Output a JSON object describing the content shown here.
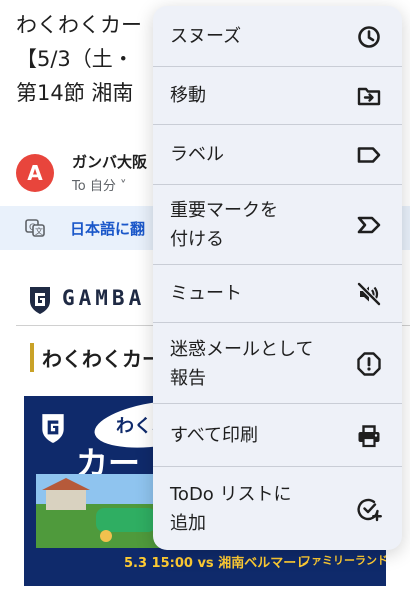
{
  "email": {
    "subject_lines": [
      "わくわくカー",
      "【5/3（土・",
      "第14節 湘南"
    ],
    "sender_name": "ガンバ大阪",
    "recipient": "To 自分 ˅",
    "avatar_letter": "A",
    "translate_text": "日本語に翻",
    "logo_text": "GAMBA",
    "section_heading": "わくわくカー",
    "banner": {
      "bubble_text": "わくわく",
      "title": "カー",
      "date_text": "5.3 15:00 vs 湘南ベルマーレ",
      "family_text": "ファミリーランド"
    }
  },
  "menu": {
    "items": [
      {
        "label": "スヌーズ",
        "icon": "clock-icon"
      },
      {
        "label": "移動",
        "icon": "move-to-folder-icon"
      },
      {
        "label": "ラベル",
        "icon": "label-icon"
      },
      {
        "label": "重要マークを\n付ける",
        "icon": "important-marker-icon"
      },
      {
        "label": "ミュート",
        "icon": "mute-icon"
      },
      {
        "label": "迷惑メールとして\n報告",
        "icon": "report-spam-icon"
      },
      {
        "label": "すべて印刷",
        "icon": "print-icon"
      },
      {
        "label": "ToDo リストに\n追加",
        "icon": "add-task-icon"
      }
    ]
  },
  "colors": {
    "menu_background": "#eef1f8",
    "avatar": "#e8453c",
    "link_blue": "#1a57c9",
    "banner_navy": "#0f2a6b",
    "accent_gold": "#c9a227"
  }
}
